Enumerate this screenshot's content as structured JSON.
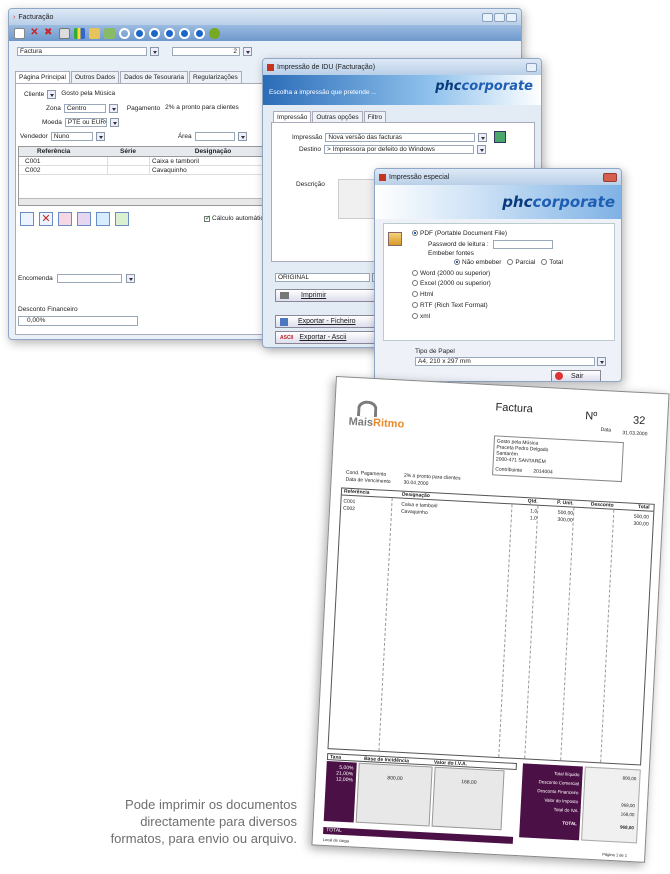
{
  "win1": {
    "title": "Facturação",
    "doc_type": "Factura",
    "doc_number": "2",
    "tabs": [
      "Página Principal",
      "Outros Dados",
      "Dados de Tesouraria",
      "Regularizações"
    ],
    "cliente_label": "Cliente",
    "cliente_value": "Gosto pela Música",
    "zona_label": "Zona",
    "zona_value": "Centro",
    "pagamento_label": "Pagamento",
    "pagamento_value": "2% a pronto para clientes",
    "moeda_label": "Moeda",
    "moeda_value": "PTE ou EURO",
    "vendedor_label": "Vendedor",
    "vendedor_value": "Nuno",
    "area_label": "Área",
    "grid_headers": [
      "Referência",
      "Série",
      "Designação"
    ],
    "grid_rows": [
      {
        "ref": "C001",
        "serie": "",
        "desig": "Caixa e tamboril"
      },
      {
        "ref": "C002",
        "serie": "",
        "desig": "Cavaquinho"
      }
    ],
    "calc_label": "Cálculo automático",
    "encomenda_label": "Encomenda",
    "desconto_label": "Desconto Financeiro",
    "desconto_value": "0,00%"
  },
  "win2": {
    "title": "Impressão de IDU (Facturação)",
    "banner_text": "Escolha a impressão que pretende ...",
    "logo_left": "phc",
    "logo_right": "corporate",
    "tabs": [
      "Impressão",
      "Outras opções",
      "Filtro"
    ],
    "impressao_label": "Impressão",
    "impressao_value": "Nova versão das facturas",
    "destino_label": "Destino",
    "destino_value": "> Impressora por defeito do Windows",
    "descricao_label": "Descrição",
    "original_value": "ORIGINAL",
    "imprimir_label": "Imprimir",
    "exportar_ficheiro": "Exportar - Ficheiro",
    "exportar_ascii": "Exportar - Ascii"
  },
  "win3": {
    "title": "Impressão especial",
    "logo_left": "phc",
    "logo_right": "corporate",
    "pdf_label": "PDF (Portable Document File)",
    "password_label": "Password de leitura :",
    "embeber_label": "Embeber fontes",
    "embed_options": [
      "Não embeber",
      "Parcial",
      "Total"
    ],
    "word_label": "Word (2000 ou superior)",
    "excel_label": "Excel (2000 ou superior)",
    "html_label": "Html",
    "rtf_label": "RTF (Rich Text Format)",
    "xml_label": "xml",
    "tipo_papel_label": "Tipo de Papel",
    "tipo_papel_value": "A4, 210 x 297 mm",
    "sair_label": "Sair"
  },
  "invoice": {
    "brand_left": "Mais",
    "brand_right": "Ritmo",
    "title": "Factura",
    "numero_label": "Nº",
    "numero_value": "32",
    "data_label": "Data",
    "data_value": "31.03.2000",
    "client_lines": [
      "Gosto pela Música",
      "Praceta Pedro Delgado",
      "Santarém",
      "2000-471 SANTARÉM"
    ],
    "contribuinte_label": "Contribuinte",
    "contribuinte_value": "2014004",
    "cond_pag_label": "Cond. Pagamento",
    "cond_pag_value": "2% a pronto para clientes",
    "data_venc_label": "Data de Vencimento",
    "data_venc_value": "30.04.2000",
    "columns": [
      "Referência",
      "Designação",
      "Qtd.",
      "P. Unit.",
      "Desconto",
      "Total"
    ],
    "rows": [
      {
        "ref": "C001",
        "desig": "Caixa e tamboril",
        "qtd": "1,0",
        "unit": "500,00",
        "total": "500,00"
      },
      {
        "ref": "C002",
        "desig": "Cavaquinho",
        "qtd": "1,0",
        "unit": "300,00",
        "total": "300,00"
      }
    ],
    "tax_headers": [
      "Taxa",
      "Base de Incidência",
      "Valor do I.V.A."
    ],
    "tax_rates": [
      "5,00%",
      "21,00%",
      "12,00%"
    ],
    "tax_base": "800,00",
    "tax_value": "168,00",
    "totals_labels": [
      "Total Ilíquido",
      "Desconto Comercial",
      "Desconto Financeiro",
      "Valor do Imposto",
      "Total do IVA",
      "TOTAL"
    ],
    "totals_values": [
      "800,00",
      "",
      "",
      "968,00",
      "168,00",
      "968,00"
    ],
    "total_label": "TOTAL",
    "footer_left": "Local de carga",
    "footer_right": "Página 1 de 1"
  },
  "caption": {
    "line1": "Pode imprimir os documentos",
    "line2": "directamente para diversos",
    "line3": "formatos, para envio ou arquivo."
  },
  "colors": {
    "accent_purple": "#4b1045",
    "phc_blue": "#1f5fb3",
    "title_bar": "#c9dbef",
    "brand_orange": "#e8892b"
  }
}
